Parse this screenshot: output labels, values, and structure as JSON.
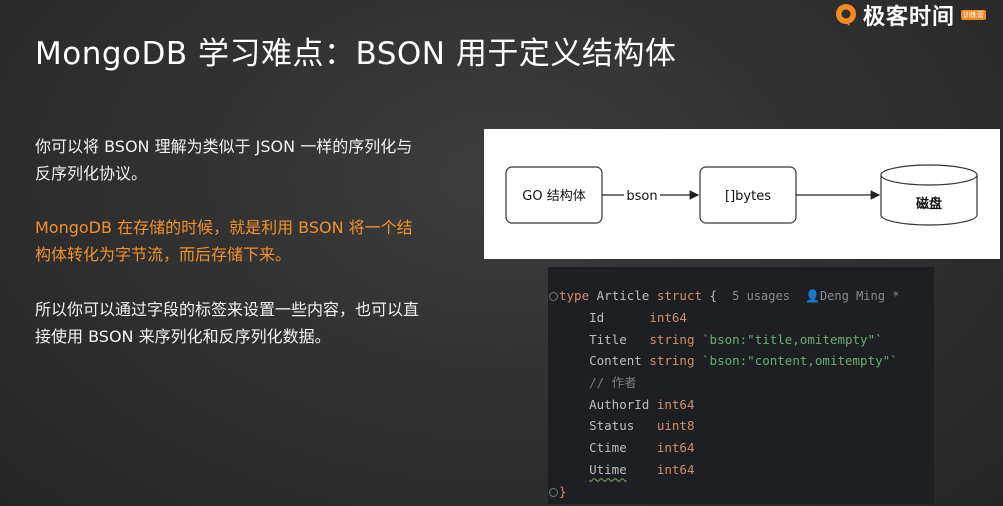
{
  "slide": {
    "title": "MongoDB 学习难点：BSON 用于定义结构体",
    "paragraphs": [
      "你可以将 BSON 理解为类似于 JSON 一样的序列化与反序列化协议。",
      "MongoDB 在存储的时候，就是利用 BSON 将一个结构体转化为字节流，而后存储下来。",
      "所以你可以通过字段的标签来设置一些内容，也可以直接使用 BSON 来序列化和反序列化数据。"
    ]
  },
  "logo": {
    "name": "极客时间",
    "sub": "训练营"
  },
  "diagram": {
    "box1": "GO 结构体",
    "edge1": "bson",
    "box2": "[]bytes",
    "box3": "磁盘"
  },
  "code": {
    "line1": {
      "kw_type": "type",
      "name": "Article",
      "kw_struct": "struct",
      "brace": "{",
      "hint_usages": "5 usages",
      "hint_author": "Deng Ming *"
    },
    "fields": [
      {
        "name": "Id",
        "type": "int64",
        "tag": ""
      },
      {
        "name": "Title",
        "type": "string",
        "tag": "`bson:\"title,omitempty\"`"
      },
      {
        "name": "Content",
        "type": "string",
        "tag": "`bson:\"content,omitempty\"`"
      },
      {
        "name": "// 作者",
        "type": "",
        "tag": ""
      },
      {
        "name": "AuthorId",
        "type": "int64",
        "tag": ""
      },
      {
        "name": "Status",
        "type": "uint8",
        "tag": ""
      },
      {
        "name": "Ctime",
        "type": "int64",
        "tag": ""
      },
      {
        "name": "Utime",
        "type": "int64",
        "tag": ""
      }
    ],
    "closing": "}"
  },
  "colors": {
    "accent_orange": "#f0922e",
    "background": "#2f2f2f",
    "code_bg": "#1e1f22"
  }
}
